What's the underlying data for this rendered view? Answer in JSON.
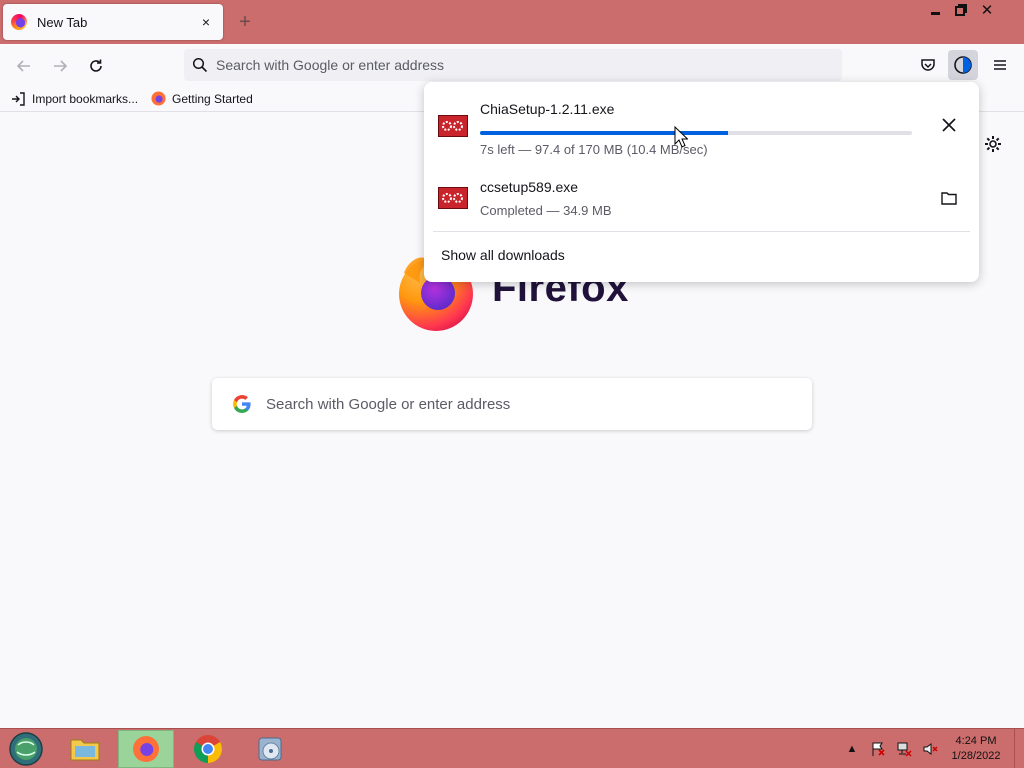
{
  "browser": {
    "tab": {
      "title": "New Tab",
      "close_icon": "×",
      "new_tab_icon": "+"
    },
    "window_controls": {
      "close": "✕"
    },
    "urlbar": {
      "placeholder": "Search with Google or enter address"
    },
    "bookmarks": [
      {
        "label": "Import bookmarks...",
        "icon": "import-icon"
      },
      {
        "label": "Getting Started",
        "icon": "firefox-icon"
      }
    ]
  },
  "newtab": {
    "wordmark": "Firefox",
    "search_placeholder": "Search with Google or enter address"
  },
  "downloads": {
    "items": [
      {
        "name": "ChiaSetup-1.2.11.exe",
        "status": "7s left — 97.4 of 170 MB (10.4 MB/sec)",
        "progress": 0.573,
        "action_icon": "close-icon",
        "action_glyph": "✕"
      },
      {
        "name": "ccsetup589.exe",
        "status": "Completed — 34.9 MB",
        "action_icon": "folder-icon"
      }
    ],
    "show_all": "Show all downloads"
  },
  "taskbar": {
    "apps": [
      "file-explorer",
      "firefox",
      "chrome",
      "disc-utility"
    ],
    "active_app": "firefox",
    "tray_arrow": "▲",
    "clock": {
      "time": "4:24 PM",
      "date": "1/28/2022"
    }
  },
  "colors": {
    "chrome": "#cc6d6d",
    "accent": "#0061e0",
    "active_taskbar": "#9bd49b"
  }
}
